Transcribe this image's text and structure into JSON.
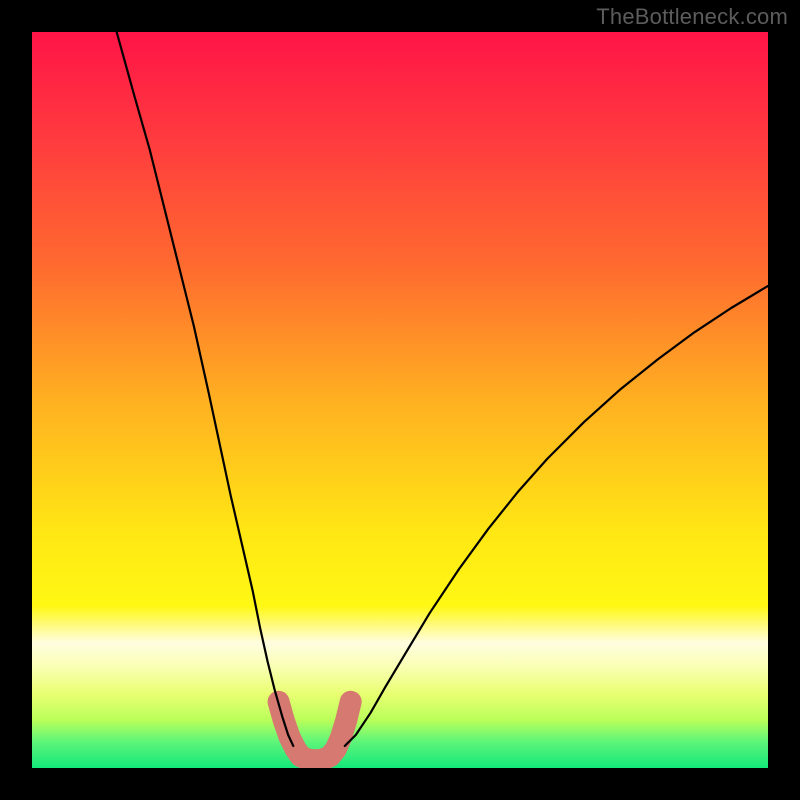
{
  "watermark": "TheBottleneck.com",
  "colors": {
    "frame": "#000000",
    "curve": "#000000",
    "marker": "#d57971",
    "gradient_stops": [
      {
        "offset": 0.0,
        "color": "#ff1447"
      },
      {
        "offset": 0.15,
        "color": "#ff3c3e"
      },
      {
        "offset": 0.32,
        "color": "#ff6b2f"
      },
      {
        "offset": 0.5,
        "color": "#ffb021"
      },
      {
        "offset": 0.68,
        "color": "#ffe714"
      },
      {
        "offset": 0.78,
        "color": "#fff814"
      },
      {
        "offset": 0.83,
        "color": "#fffde0"
      },
      {
        "offset": 0.86,
        "color": "#faffb7"
      },
      {
        "offset": 0.9,
        "color": "#e8ff70"
      },
      {
        "offset": 0.935,
        "color": "#b9ff5a"
      },
      {
        "offset": 0.965,
        "color": "#5cf57a"
      },
      {
        "offset": 1.0,
        "color": "#14e77a"
      }
    ]
  },
  "chart_data": {
    "type": "line",
    "title": "",
    "xlabel": "",
    "ylabel": "",
    "xlim": [
      0,
      100
    ],
    "ylim": [
      0,
      100
    ],
    "grid": false,
    "legend": false,
    "series": [
      {
        "name": "left-curve",
        "x": [
          11.5,
          14,
          16,
          18,
          20,
          22,
          24,
          25.5,
          27,
          28.5,
          30,
          31,
          32,
          33,
          34,
          34.8,
          35.5
        ],
        "y": [
          100,
          91,
          84,
          76,
          68,
          60,
          51,
          44,
          37,
          30.5,
          24,
          19,
          14.5,
          10.5,
          7,
          4.5,
          3
        ]
      },
      {
        "name": "right-curve",
        "x": [
          42.5,
          44,
          46,
          48,
          51,
          54,
          58,
          62,
          66,
          70,
          75,
          80,
          85,
          90,
          95,
          100
        ],
        "y": [
          3,
          4.5,
          7.5,
          11,
          16,
          21,
          27,
          32.5,
          37.5,
          42,
          47,
          51.5,
          55.5,
          59.2,
          62.5,
          65.5
        ]
      },
      {
        "name": "bottom-marker",
        "x": [
          33.5,
          34.2,
          35,
          35.8,
          36.5,
          37.5,
          38.5,
          39.5,
          40.5,
          41.3,
          42,
          42.7,
          43.3
        ],
        "y": [
          9.0,
          6.5,
          4.2,
          2.6,
          1.6,
          1.15,
          1.05,
          1.15,
          1.6,
          2.6,
          4.2,
          6.5,
          9.0
        ]
      }
    ],
    "marker_style": {
      "series": "bottom-marker",
      "stroke_width_px": 22,
      "color_key": "marker"
    }
  }
}
